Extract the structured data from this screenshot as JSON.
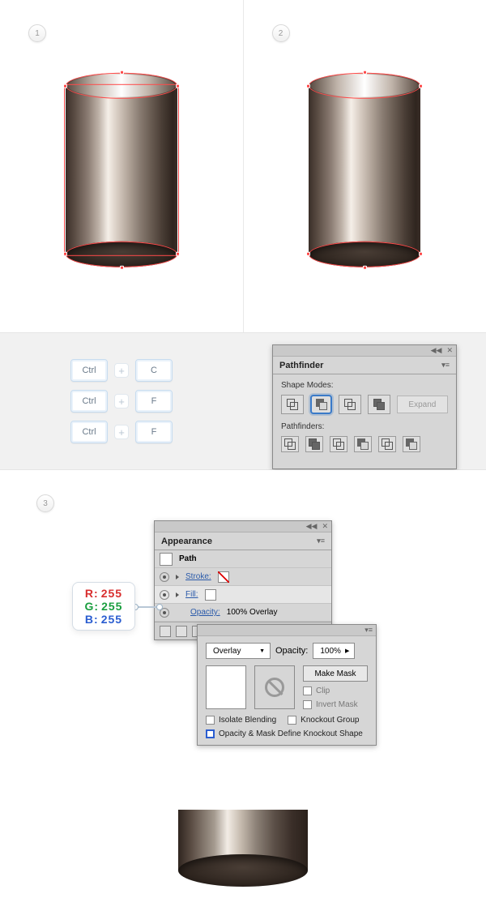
{
  "steps": {
    "s1": "1",
    "s2": "2",
    "s3": "3"
  },
  "shortcuts": {
    "rows": [
      {
        "k1": "Ctrl",
        "k2": "C"
      },
      {
        "k1": "Ctrl",
        "k2": "F"
      },
      {
        "k1": "Ctrl",
        "k2": "F"
      }
    ],
    "plus": "+"
  },
  "pathfinder": {
    "title": "Pathfinder",
    "label_shape": "Shape Modes:",
    "label_pf": "Pathfinders:",
    "expand": "Expand"
  },
  "appearance": {
    "title": "Appearance",
    "path": "Path",
    "stroke": "Stroke:",
    "fill": "Fill:",
    "opacity_lbl": "Opacity:",
    "opacity_val": "100% Overlay"
  },
  "transparency": {
    "mode": "Overlay",
    "opacity_lbl": "Opacity:",
    "opacity_val": "100%",
    "make_mask": "Make Mask",
    "clip": "Clip",
    "invert": "Invert Mask",
    "isolate": "Isolate Blending",
    "knockout": "Knockout Group",
    "define": "Opacity & Mask Define Knockout Shape"
  },
  "rgb": {
    "r_lbl": "R:",
    "g_lbl": "G:",
    "b_lbl": "B:",
    "r": "255",
    "g": "255",
    "b": "255"
  }
}
